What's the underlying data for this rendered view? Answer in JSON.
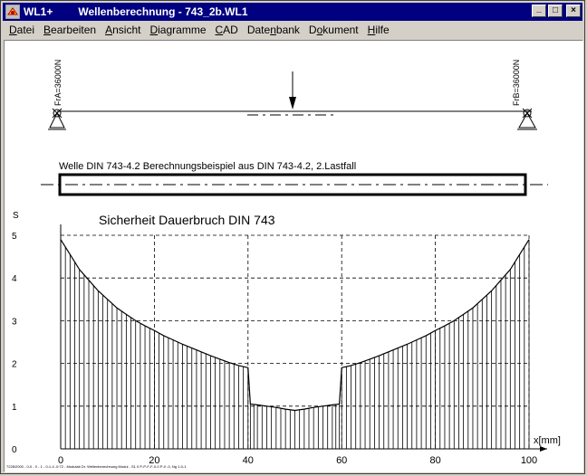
{
  "window": {
    "app_name": "WL1+",
    "title": "Wellenberechnung  -  743_2b.WL1",
    "buttons": [
      "_",
      "□",
      "×"
    ]
  },
  "menu": [
    {
      "label": "Datei",
      "accel": "D"
    },
    {
      "label": "Bearbeiten",
      "accel": "B"
    },
    {
      "label": "Ansicht",
      "accel": "A"
    },
    {
      "label": "Diagramme",
      "accel": "D"
    },
    {
      "label": "CAD",
      "accel": "C"
    },
    {
      "label": "Datenbank",
      "accel": "n"
    },
    {
      "label": "Dokument",
      "accel": "o"
    },
    {
      "label": "Hilfe",
      "accel": "H"
    }
  ],
  "beam": {
    "support_left_label": "FrA=36000N",
    "support_right_label": "FrB=36000N"
  },
  "shaft": {
    "title": "Welle DIN 743-4.2  Berechnungsbeispiel aus DIN 743-4.2, 2.Lastfall"
  },
  "chart_data": {
    "type": "area",
    "title": "Sicherheit Dauerbruch DIN 743",
    "xlabel": "x[mm]",
    "ylabel": "S",
    "xlim": [
      0,
      100
    ],
    "ylim": [
      0,
      5
    ],
    "xticks": [
      "0",
      "20",
      "40",
      "60",
      "80",
      "100"
    ],
    "yticks": [
      "0",
      "1",
      "2",
      "3",
      "4",
      "5"
    ],
    "grid": true,
    "series": [
      {
        "x": [
          0,
          2,
          4,
          6,
          8,
          10,
          12,
          14,
          16,
          18,
          20,
          22,
          24,
          26,
          28,
          30,
          32,
          34,
          36,
          38,
          40,
          40.5,
          42,
          44,
          46,
          48,
          50,
          52,
          54,
          56,
          58,
          59.5,
          60,
          62,
          64,
          66,
          68,
          70,
          72,
          74,
          76,
          78,
          80,
          82,
          84,
          86,
          88,
          90,
          92,
          94,
          96,
          98,
          100
        ],
        "y": [
          4.9,
          4.55,
          4.2,
          3.95,
          3.7,
          3.5,
          3.3,
          3.15,
          3.0,
          2.88,
          2.77,
          2.65,
          2.55,
          2.45,
          2.36,
          2.27,
          2.18,
          2.1,
          2.02,
          1.95,
          1.9,
          1.05,
          1.03,
          1.0,
          0.97,
          0.93,
          0.9,
          0.93,
          0.97,
          1.0,
          1.03,
          1.05,
          1.9,
          1.95,
          2.02,
          2.1,
          2.18,
          2.27,
          2.36,
          2.45,
          2.55,
          2.65,
          2.77,
          2.88,
          3.0,
          3.15,
          3.3,
          3.5,
          3.7,
          3.95,
          4.2,
          4.55,
          4.9
        ]
      }
    ]
  },
  "footer": {
    "small_text": "7228/2000 - 0-0 - 0 - 1 - 0-1-4 -0:72 - Modulab Dr. Wellenberechnung Modul - S1 0 P-P-F-F-0-0 P-0 -0, Ng 1-0-1"
  }
}
